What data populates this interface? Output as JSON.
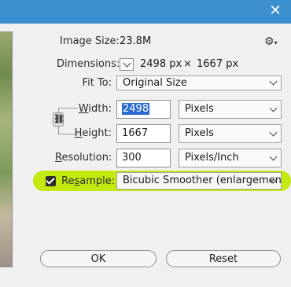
{
  "window": {
    "close_glyph": "✕"
  },
  "image_size": {
    "label": "Image Size:",
    "value": "23.8M"
  },
  "dimensions": {
    "label": "Dimensions:",
    "width": "2498 px",
    "times": "×",
    "height": "1667 px"
  },
  "fit_to": {
    "label": "Fit To:",
    "value": "Original Size"
  },
  "width": {
    "label_m": "W",
    "label_rest": "idth:",
    "value": "2498",
    "unit": "Pixels"
  },
  "height": {
    "label_m": "H",
    "label_rest": "eight:",
    "value": "1667",
    "unit": "Pixels"
  },
  "resolution": {
    "label_m": "R",
    "label_rest": "esolution:",
    "value": "300",
    "unit": "Pixels/Inch"
  },
  "resample": {
    "label_pre": "Re",
    "label_m": "s",
    "label_rest": "ample:",
    "checked": true,
    "method": "Bicubic Smoother (enlargement)"
  },
  "buttons": {
    "ok": "OK",
    "reset": "Reset"
  },
  "icons": {
    "settings": "gear-icon",
    "link": "chain-link-icon",
    "close": "close-icon"
  },
  "colors": {
    "titlebar": "#3c8fcf",
    "highlight": "#c3ea10",
    "selection": "#2a6ad1"
  }
}
